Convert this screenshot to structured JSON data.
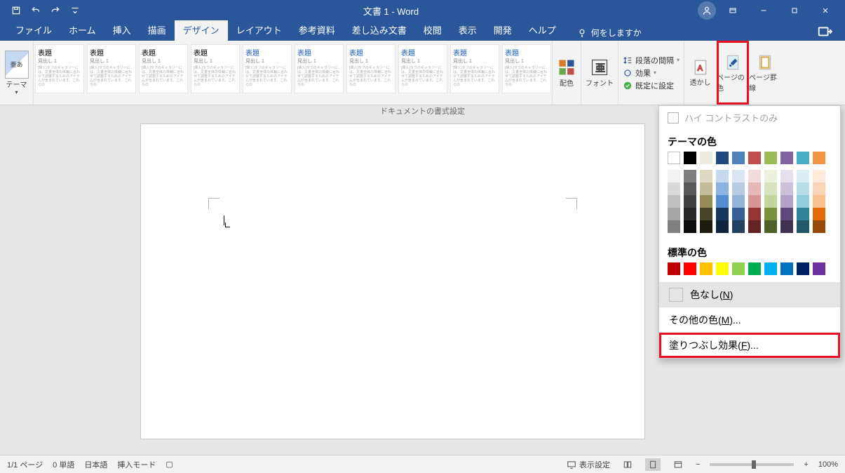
{
  "title": "文書 1  -  Word",
  "qat": {
    "save": "保存",
    "undo": "元に戻す",
    "redo": "やり直し"
  },
  "tabs": [
    "ファイル",
    "ホーム",
    "挿入",
    "描画",
    "デザイン",
    "レイアウト",
    "参考資料",
    "差し込み文書",
    "校閲",
    "表示",
    "開発",
    "ヘルプ"
  ],
  "active_tab_index": 4,
  "tell_me": "何をしますか",
  "ribbon": {
    "theme_label": "テーマ",
    "theme_glyph": "亜あ",
    "doc_format_label": "ドキュメントの書式設定",
    "styles": [
      {
        "h": "表題",
        "s": "見出し 1",
        "accent": false
      },
      {
        "h": "表題",
        "s": "見出し 1",
        "accent": false
      },
      {
        "h": "表題",
        "s": "見出し 1",
        "accent": false
      },
      {
        "h": "表題",
        "s": "見出し 1",
        "accent": false
      },
      {
        "h": "表題",
        "s": "見出し 1",
        "accent": true
      },
      {
        "h": "表題",
        "s": "見出し 1",
        "accent": true
      },
      {
        "h": "表題",
        "s": "見出し 1",
        "accent": true
      },
      {
        "h": "表題",
        "s": "見出し 1",
        "accent": true
      },
      {
        "h": "表題",
        "s": "見出し 1",
        "accent": true
      },
      {
        "h": "表題",
        "s": "見出し 1",
        "accent": true
      }
    ],
    "colors_label": "配色",
    "fonts_label": "フォント",
    "para_spacing": "段落の間隔",
    "effects": "効果",
    "set_default": "既定に設定",
    "watermark": "透かし",
    "page_color": "ページの色",
    "page_border": "ページ罫線"
  },
  "dropdown": {
    "high_contrast": "ハイ コントラストのみ",
    "theme_colors": "テーマの色",
    "theme_row": [
      "#ffffff",
      "#000000",
      "#eeece1",
      "#1f497d",
      "#4f81bd",
      "#c0504d",
      "#9bbb59",
      "#8064a2",
      "#4bacc6",
      "#f79646"
    ],
    "shade_cols": [
      [
        "#f2f2f2",
        "#d9d9d9",
        "#bfbfbf",
        "#a6a6a6",
        "#808080"
      ],
      [
        "#7f7f7f",
        "#595959",
        "#404040",
        "#262626",
        "#0d0d0d"
      ],
      [
        "#ddd9c3",
        "#c4bd97",
        "#948a54",
        "#494529",
        "#1d1b10"
      ],
      [
        "#c6d9f0",
        "#8db3e2",
        "#548dd4",
        "#17365d",
        "#0f243e"
      ],
      [
        "#dbe5f1",
        "#b8cce4",
        "#95b3d7",
        "#366092",
        "#244061"
      ],
      [
        "#f2dcdb",
        "#e5b9b7",
        "#d99694",
        "#953734",
        "#632423"
      ],
      [
        "#ebf1dd",
        "#d7e3bc",
        "#c3d69b",
        "#76923c",
        "#4f6128"
      ],
      [
        "#e5e0ec",
        "#ccc1d9",
        "#b2a2c7",
        "#5f497a",
        "#3f3151"
      ],
      [
        "#dbeef3",
        "#b7dde8",
        "#92cddc",
        "#31859b",
        "#205867"
      ],
      [
        "#fdeada",
        "#fbd5b5",
        "#fac08f",
        "#e36c09",
        "#974806"
      ]
    ],
    "standard_colors": "標準の色",
    "standard_row": [
      "#c00000",
      "#ff0000",
      "#ffc000",
      "#ffff00",
      "#92d050",
      "#00b050",
      "#00b0f0",
      "#0070c0",
      "#002060",
      "#7030a0"
    ],
    "no_color": "色なし(",
    "no_color_key": "N",
    "more_colors": "その他の色(",
    "more_colors_key": "M",
    "fill_effects": "塗りつぶし効果(",
    "fill_effects_key": "F",
    "paren_end": ")",
    "ell": "..."
  },
  "status": {
    "page": "1/1 ページ",
    "words": "0 単語",
    "lang": "日本語",
    "mode": "挿入モード",
    "display": "表示設定",
    "zoom": "100%"
  }
}
